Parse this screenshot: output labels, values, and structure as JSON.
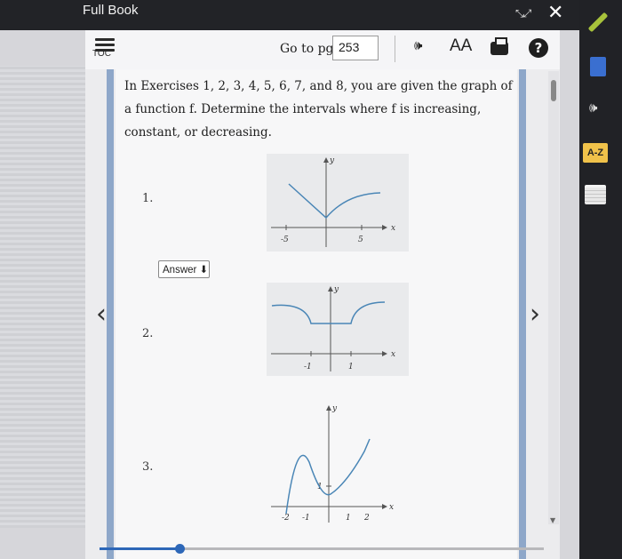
{
  "window": {
    "title": "Full Book"
  },
  "toolbar": {
    "toc_label": "TOC",
    "goto_label": "Go to pg.",
    "page_number": "253",
    "text_size_label": "AA",
    "help_label": "?"
  },
  "content": {
    "intro": "In Exercises 1, 2, 3, 4, 5, 6, 7, and 8, you are given the graph of a function f. Determine the intervals where f is increasing, constant, or decreasing.",
    "exercises": [
      {
        "number": "1.",
        "graph_ticks": [
          "-5",
          "5"
        ],
        "axis_x": "x",
        "axis_y": "y"
      },
      {
        "number": "2.",
        "graph_ticks": [
          "-1",
          "1"
        ],
        "axis_x": "x",
        "axis_y": "y"
      },
      {
        "number": "3.",
        "graph_ticks": [
          "-2",
          "-1",
          "1",
          "2"
        ],
        "y_tick": "1",
        "axis_x": "x",
        "axis_y": "y"
      }
    ],
    "answer_button": "Answer ⬇"
  },
  "progress": {
    "fraction": 0.18
  },
  "rail": {
    "glossary_label": "A-Z"
  },
  "icons": {
    "fullscreen": "fullscreen-icon",
    "close": "close-icon",
    "audio": "audio-icon",
    "print": "print-icon",
    "pencil": "pencil-icon",
    "notebook": "notebook-icon",
    "highlight": "highlight-icon"
  },
  "colors": {
    "accent": "#2d67b8",
    "curve": "#4a86b6",
    "nav_bar": "#8ea7c9"
  }
}
